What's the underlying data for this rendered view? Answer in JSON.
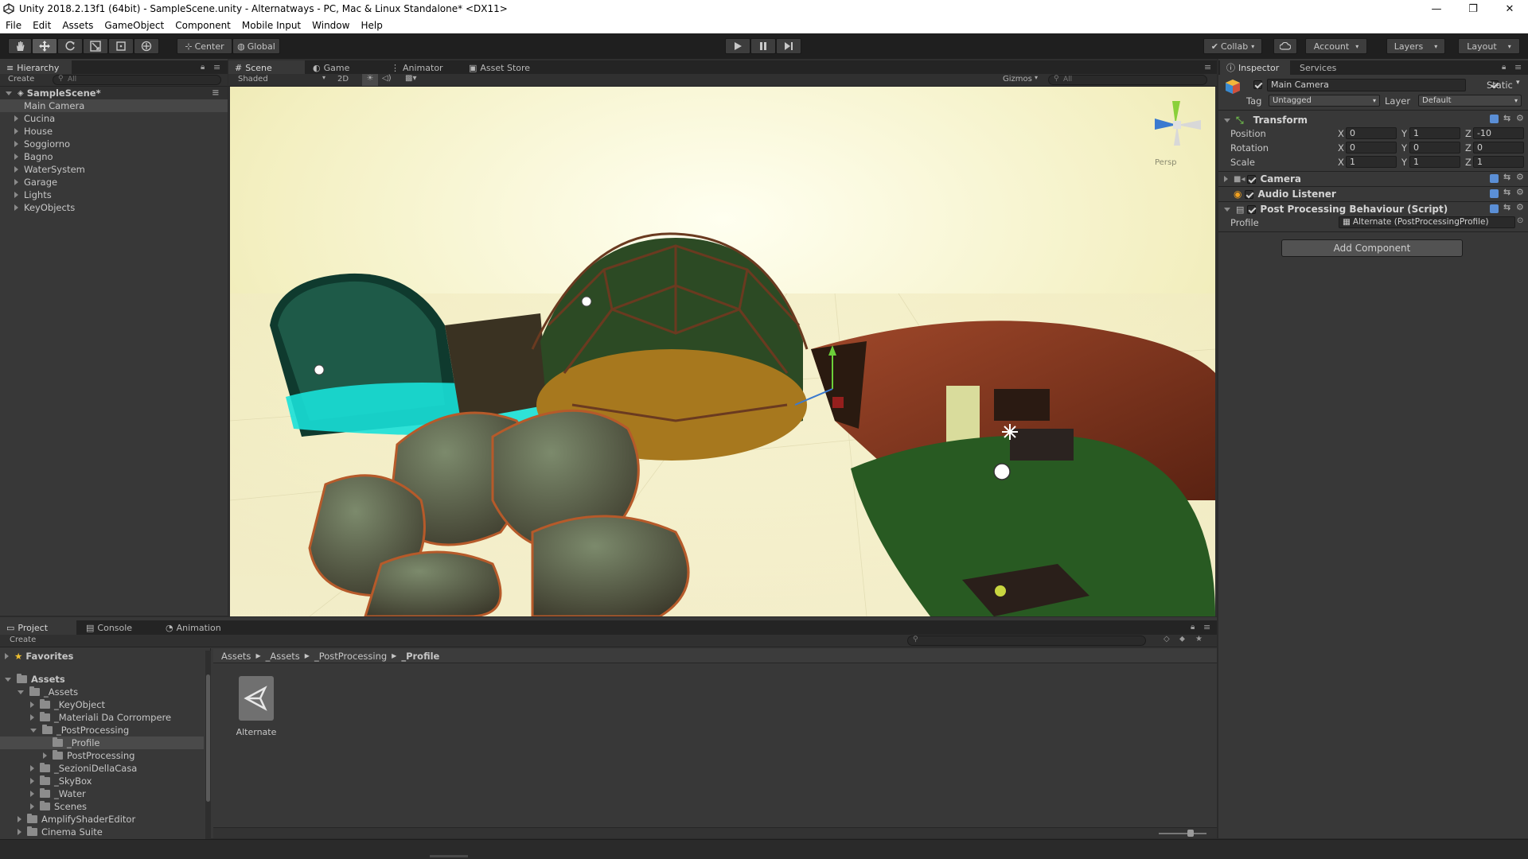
{
  "window": {
    "title": "Unity 2018.2.13f1 (64bit) - SampleScene.unity - Alternatways - PC, Mac & Linux Standalone* <DX11>",
    "minimize": "—",
    "maximize": "❐",
    "close": "✕"
  },
  "menu": [
    "File",
    "Edit",
    "Assets",
    "GameObject",
    "Component",
    "Mobile Input",
    "Window",
    "Help"
  ],
  "toolbar": {
    "pivot_label": "Center",
    "space_label": "Global",
    "collab_label": "Collab",
    "account_label": "Account",
    "layers_label": "Layers",
    "layout_label": "Layout"
  },
  "hierarchy": {
    "tab_label": "Hierarchy",
    "create_label": "Create",
    "search_placeholder": "All",
    "scene_name": "SampleScene*",
    "items": [
      "Main Camera",
      "Cucina",
      "House",
      "Soggiorno",
      "Bagno",
      "WaterSystem",
      "Garage",
      "Lights",
      "KeyObjects"
    ]
  },
  "scene_view": {
    "tabs": [
      "Scene",
      "Game",
      "Animator",
      "Asset Store"
    ],
    "shading_mode": "Shaded",
    "mode_2d": "2D",
    "gizmos_label": "Gizmos",
    "search_placeholder": "All",
    "persp_label": "Persp"
  },
  "inspector": {
    "tabs": [
      "Inspector",
      "Services"
    ],
    "object_name": "Main Camera",
    "static_label": "Static",
    "tag_label": "Tag",
    "tag_value": "Untagged",
    "layer_label": "Layer",
    "layer_value": "Default",
    "transform": {
      "title": "Transform",
      "position_label": "Position",
      "rotation_label": "Rotation",
      "scale_label": "Scale",
      "axis_x": "X",
      "axis_y": "Y",
      "axis_z": "Z",
      "position": [
        "0",
        "1",
        "-10"
      ],
      "rotation": [
        "0",
        "0",
        "0"
      ],
      "scale": [
        "1",
        "1",
        "1"
      ]
    },
    "components": [
      "Camera",
      "Audio Listener",
      "Post Processing Behaviour (Script)"
    ],
    "profile_label": "Profile",
    "profile_value": "Alternate (PostProcessingProfile)",
    "add_component": "Add Component"
  },
  "project": {
    "tabs": [
      "Project",
      "Console",
      "Animation"
    ],
    "create_label": "Create",
    "favorites_label": "Favorites",
    "assets_label": "Assets",
    "tree": [
      {
        "label": "_Assets",
        "depth": 1,
        "open": true
      },
      {
        "label": "_KeyObject",
        "depth": 2,
        "open": false
      },
      {
        "label": "_Materiali Da Corrompere",
        "depth": 2,
        "open": false
      },
      {
        "label": "_PostProcessing",
        "depth": 2,
        "open": true
      },
      {
        "label": "_Profile",
        "depth": 3,
        "open": false
      },
      {
        "label": "PostProcessing",
        "depth": 3,
        "open": false
      },
      {
        "label": "_SezioniDellaCasa",
        "depth": 2,
        "open": false
      },
      {
        "label": "_SkyBox",
        "depth": 2,
        "open": false
      },
      {
        "label": "_Water",
        "depth": 2,
        "open": false
      },
      {
        "label": "Scenes",
        "depth": 2,
        "open": false
      },
      {
        "label": "AmplifyShaderEditor",
        "depth": 1,
        "open": false
      },
      {
        "label": "Cinema Suite",
        "depth": 1,
        "open": false
      }
    ],
    "breadcrumb": [
      "Assets",
      "_Assets",
      "_PostProcessing",
      "_Profile"
    ],
    "asset_name": "Alternate"
  },
  "colors": {
    "editor_bg": "#383838",
    "toolbar_bg": "#1f1f1f",
    "selection": "#4a4a4a",
    "accent_blue": "#3f6fb0"
  }
}
